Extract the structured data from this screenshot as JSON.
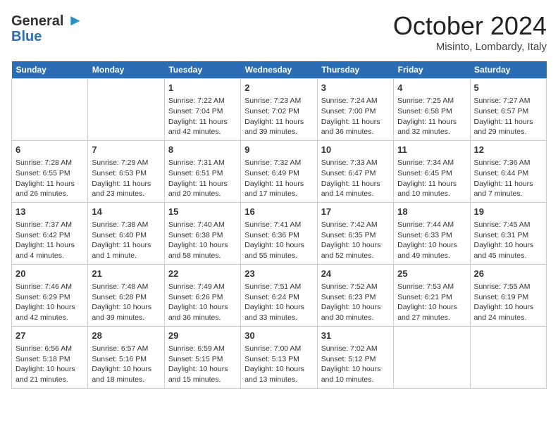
{
  "header": {
    "logo_line1": "General",
    "logo_line2": "Blue",
    "month": "October 2024",
    "location": "Misinto, Lombardy, Italy"
  },
  "weekdays": [
    "Sunday",
    "Monday",
    "Tuesday",
    "Wednesday",
    "Thursday",
    "Friday",
    "Saturday"
  ],
  "weeks": [
    [
      {
        "day": "",
        "sunrise": "",
        "sunset": "",
        "daylight": ""
      },
      {
        "day": "",
        "sunrise": "",
        "sunset": "",
        "daylight": ""
      },
      {
        "day": "1",
        "sunrise": "Sunrise: 7:22 AM",
        "sunset": "Sunset: 7:04 PM",
        "daylight": "Daylight: 11 hours and 42 minutes."
      },
      {
        "day": "2",
        "sunrise": "Sunrise: 7:23 AM",
        "sunset": "Sunset: 7:02 PM",
        "daylight": "Daylight: 11 hours and 39 minutes."
      },
      {
        "day": "3",
        "sunrise": "Sunrise: 7:24 AM",
        "sunset": "Sunset: 7:00 PM",
        "daylight": "Daylight: 11 hours and 36 minutes."
      },
      {
        "day": "4",
        "sunrise": "Sunrise: 7:25 AM",
        "sunset": "Sunset: 6:58 PM",
        "daylight": "Daylight: 11 hours and 32 minutes."
      },
      {
        "day": "5",
        "sunrise": "Sunrise: 7:27 AM",
        "sunset": "Sunset: 6:57 PM",
        "daylight": "Daylight: 11 hours and 29 minutes."
      }
    ],
    [
      {
        "day": "6",
        "sunrise": "Sunrise: 7:28 AM",
        "sunset": "Sunset: 6:55 PM",
        "daylight": "Daylight: 11 hours and 26 minutes."
      },
      {
        "day": "7",
        "sunrise": "Sunrise: 7:29 AM",
        "sunset": "Sunset: 6:53 PM",
        "daylight": "Daylight: 11 hours and 23 minutes."
      },
      {
        "day": "8",
        "sunrise": "Sunrise: 7:31 AM",
        "sunset": "Sunset: 6:51 PM",
        "daylight": "Daylight: 11 hours and 20 minutes."
      },
      {
        "day": "9",
        "sunrise": "Sunrise: 7:32 AM",
        "sunset": "Sunset: 6:49 PM",
        "daylight": "Daylight: 11 hours and 17 minutes."
      },
      {
        "day": "10",
        "sunrise": "Sunrise: 7:33 AM",
        "sunset": "Sunset: 6:47 PM",
        "daylight": "Daylight: 11 hours and 14 minutes."
      },
      {
        "day": "11",
        "sunrise": "Sunrise: 7:34 AM",
        "sunset": "Sunset: 6:45 PM",
        "daylight": "Daylight: 11 hours and 10 minutes."
      },
      {
        "day": "12",
        "sunrise": "Sunrise: 7:36 AM",
        "sunset": "Sunset: 6:44 PM",
        "daylight": "Daylight: 11 hours and 7 minutes."
      }
    ],
    [
      {
        "day": "13",
        "sunrise": "Sunrise: 7:37 AM",
        "sunset": "Sunset: 6:42 PM",
        "daylight": "Daylight: 11 hours and 4 minutes."
      },
      {
        "day": "14",
        "sunrise": "Sunrise: 7:38 AM",
        "sunset": "Sunset: 6:40 PM",
        "daylight": "Daylight: 11 hours and 1 minute."
      },
      {
        "day": "15",
        "sunrise": "Sunrise: 7:40 AM",
        "sunset": "Sunset: 6:38 PM",
        "daylight": "Daylight: 10 hours and 58 minutes."
      },
      {
        "day": "16",
        "sunrise": "Sunrise: 7:41 AM",
        "sunset": "Sunset: 6:36 PM",
        "daylight": "Daylight: 10 hours and 55 minutes."
      },
      {
        "day": "17",
        "sunrise": "Sunrise: 7:42 AM",
        "sunset": "Sunset: 6:35 PM",
        "daylight": "Daylight: 10 hours and 52 minutes."
      },
      {
        "day": "18",
        "sunrise": "Sunrise: 7:44 AM",
        "sunset": "Sunset: 6:33 PM",
        "daylight": "Daylight: 10 hours and 49 minutes."
      },
      {
        "day": "19",
        "sunrise": "Sunrise: 7:45 AM",
        "sunset": "Sunset: 6:31 PM",
        "daylight": "Daylight: 10 hours and 45 minutes."
      }
    ],
    [
      {
        "day": "20",
        "sunrise": "Sunrise: 7:46 AM",
        "sunset": "Sunset: 6:29 PM",
        "daylight": "Daylight: 10 hours and 42 minutes."
      },
      {
        "day": "21",
        "sunrise": "Sunrise: 7:48 AM",
        "sunset": "Sunset: 6:28 PM",
        "daylight": "Daylight: 10 hours and 39 minutes."
      },
      {
        "day": "22",
        "sunrise": "Sunrise: 7:49 AM",
        "sunset": "Sunset: 6:26 PM",
        "daylight": "Daylight: 10 hours and 36 minutes."
      },
      {
        "day": "23",
        "sunrise": "Sunrise: 7:51 AM",
        "sunset": "Sunset: 6:24 PM",
        "daylight": "Daylight: 10 hours and 33 minutes."
      },
      {
        "day": "24",
        "sunrise": "Sunrise: 7:52 AM",
        "sunset": "Sunset: 6:23 PM",
        "daylight": "Daylight: 10 hours and 30 minutes."
      },
      {
        "day": "25",
        "sunrise": "Sunrise: 7:53 AM",
        "sunset": "Sunset: 6:21 PM",
        "daylight": "Daylight: 10 hours and 27 minutes."
      },
      {
        "day": "26",
        "sunrise": "Sunrise: 7:55 AM",
        "sunset": "Sunset: 6:19 PM",
        "daylight": "Daylight: 10 hours and 24 minutes."
      }
    ],
    [
      {
        "day": "27",
        "sunrise": "Sunrise: 6:56 AM",
        "sunset": "Sunset: 5:18 PM",
        "daylight": "Daylight: 10 hours and 21 minutes."
      },
      {
        "day": "28",
        "sunrise": "Sunrise: 6:57 AM",
        "sunset": "Sunset: 5:16 PM",
        "daylight": "Daylight: 10 hours and 18 minutes."
      },
      {
        "day": "29",
        "sunrise": "Sunrise: 6:59 AM",
        "sunset": "Sunset: 5:15 PM",
        "daylight": "Daylight: 10 hours and 15 minutes."
      },
      {
        "day": "30",
        "sunrise": "Sunrise: 7:00 AM",
        "sunset": "Sunset: 5:13 PM",
        "daylight": "Daylight: 10 hours and 13 minutes."
      },
      {
        "day": "31",
        "sunrise": "Sunrise: 7:02 AM",
        "sunset": "Sunset: 5:12 PM",
        "daylight": "Daylight: 10 hours and 10 minutes."
      },
      {
        "day": "",
        "sunrise": "",
        "sunset": "",
        "daylight": ""
      },
      {
        "day": "",
        "sunrise": "",
        "sunset": "",
        "daylight": ""
      }
    ]
  ]
}
